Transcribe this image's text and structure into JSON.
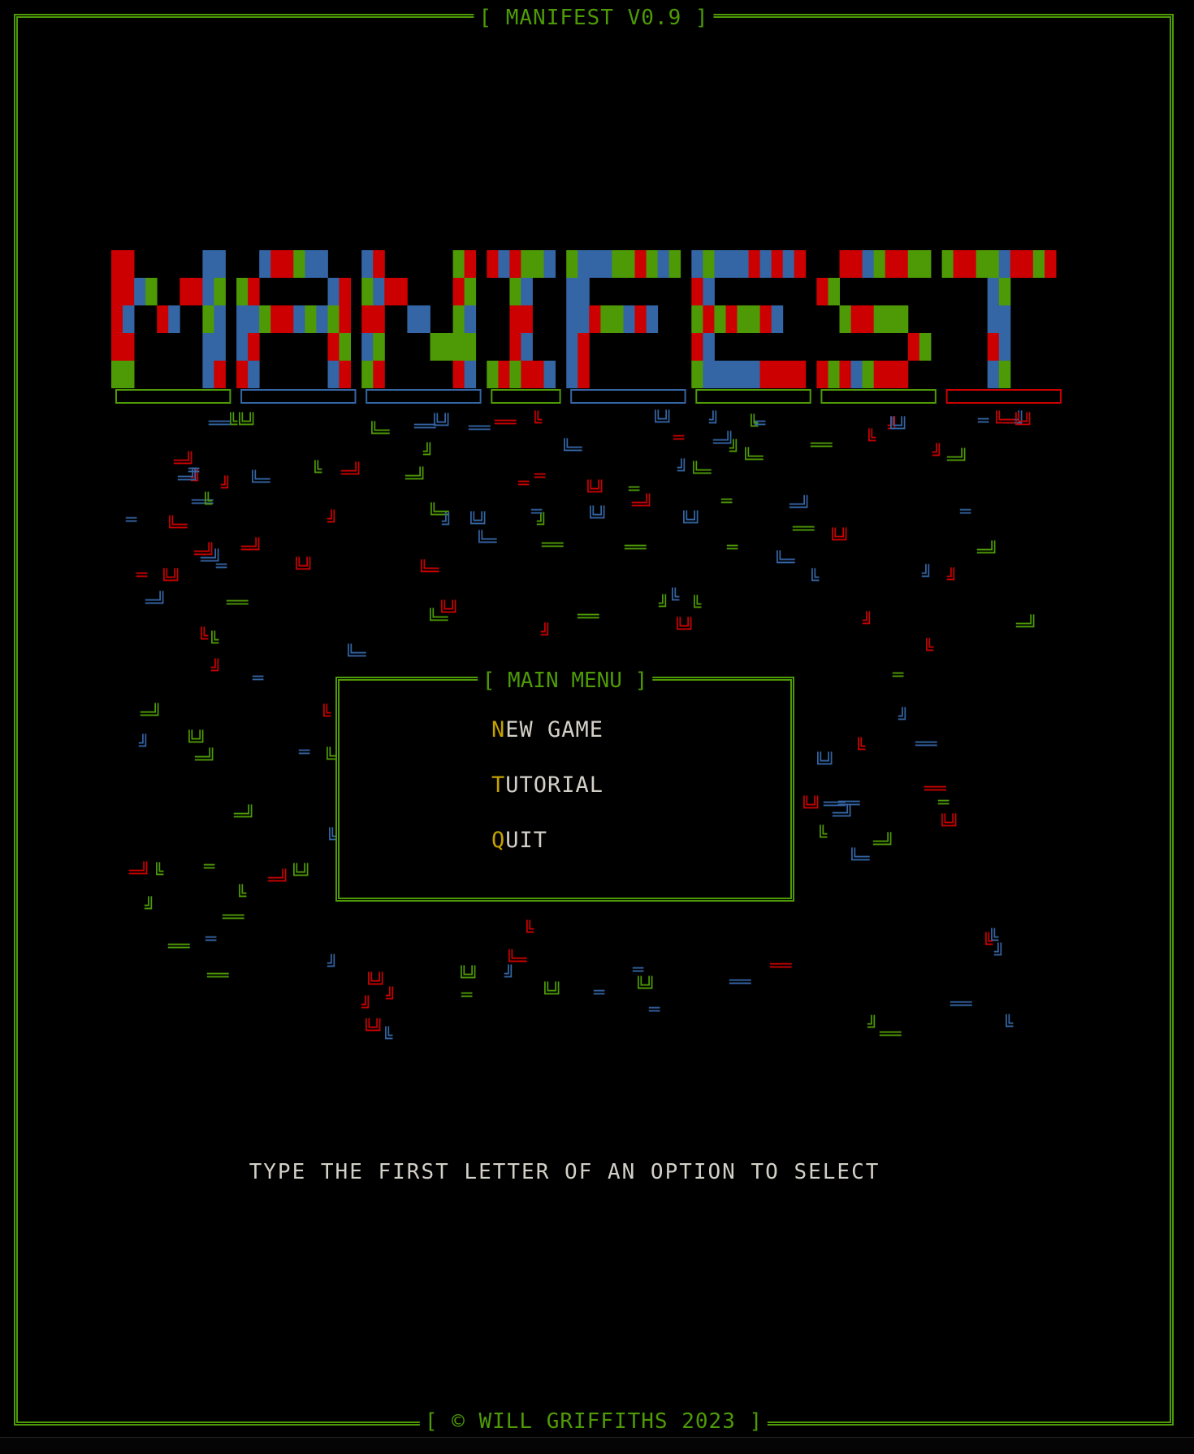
{
  "window": {
    "title": "[ MANIFEST V0.9 ]",
    "footer": "[ © WILL GRIFFITHS 2023 ]"
  },
  "logo": {
    "text": "MANIFEST",
    "colors": [
      "#3465a4",
      "#cc0000",
      "#4e9a06"
    ]
  },
  "menu": {
    "title": "[ MAIN MENU ]",
    "items": [
      {
        "hotkey": "N",
        "rest": "EW GAME"
      },
      {
        "hotkey": "T",
        "rest": "UTORIAL"
      },
      {
        "hotkey": "Q",
        "rest": "UIT"
      }
    ]
  },
  "hint": "TYPE THE FIRST LETTER OF AN OPTION TO SELECT",
  "colors": {
    "frame": "#4e9a06",
    "text": "#d3d0c8",
    "hotkey": "#c4a000",
    "background": "#000000"
  }
}
